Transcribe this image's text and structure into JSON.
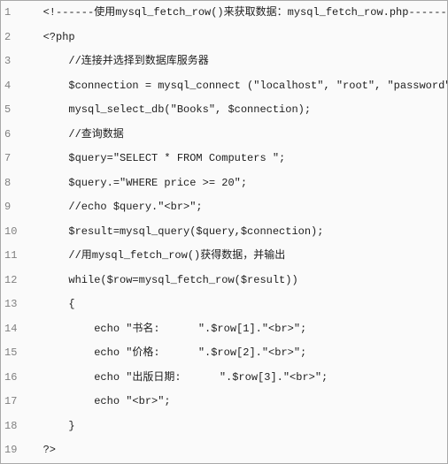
{
  "lines": [
    {
      "num": "1",
      "code": "   <!------使用mysql_fetch_row()来获取数据：mysql_fetch_row.php------>"
    },
    {
      "num": "2",
      "code": "   <?php"
    },
    {
      "num": "3",
      "code": "       //连接并选择到数据库服务器"
    },
    {
      "num": "4",
      "code": "       $connection = mysql_connect (\"localhost\", \"root\", \"password\")"
    },
    {
      "num": "5",
      "code": "       mysql_select_db(\"Books\", $connection);"
    },
    {
      "num": "6",
      "code": "       //查询数据"
    },
    {
      "num": "7",
      "code": "       $query=\"SELECT * FROM Computers \";"
    },
    {
      "num": "8",
      "code": "       $query.=\"WHERE price >= 20\";"
    },
    {
      "num": "9",
      "code": "       //echo $query.\"<br>\";"
    },
    {
      "num": "10",
      "code": "       $result=mysql_query($query,$connection);"
    },
    {
      "num": "11",
      "code": "       //用mysql_fetch_row()获得数据，并输出"
    },
    {
      "num": "12",
      "code": "       while($row=mysql_fetch_row($result))"
    },
    {
      "num": "13",
      "code": "       {"
    },
    {
      "num": "14",
      "code": "           echo \"书名:      \".$row[1].\"<br>\";"
    },
    {
      "num": "15",
      "code": "           echo \"价格:      \".$row[2].\"<br>\";"
    },
    {
      "num": "16",
      "code": "           echo \"出版日期:      \".$row[3].\"<br>\";"
    },
    {
      "num": "17",
      "code": "           echo \"<br>\";"
    },
    {
      "num": "18",
      "code": "       }"
    },
    {
      "num": "19",
      "code": "   ?>"
    }
  ]
}
